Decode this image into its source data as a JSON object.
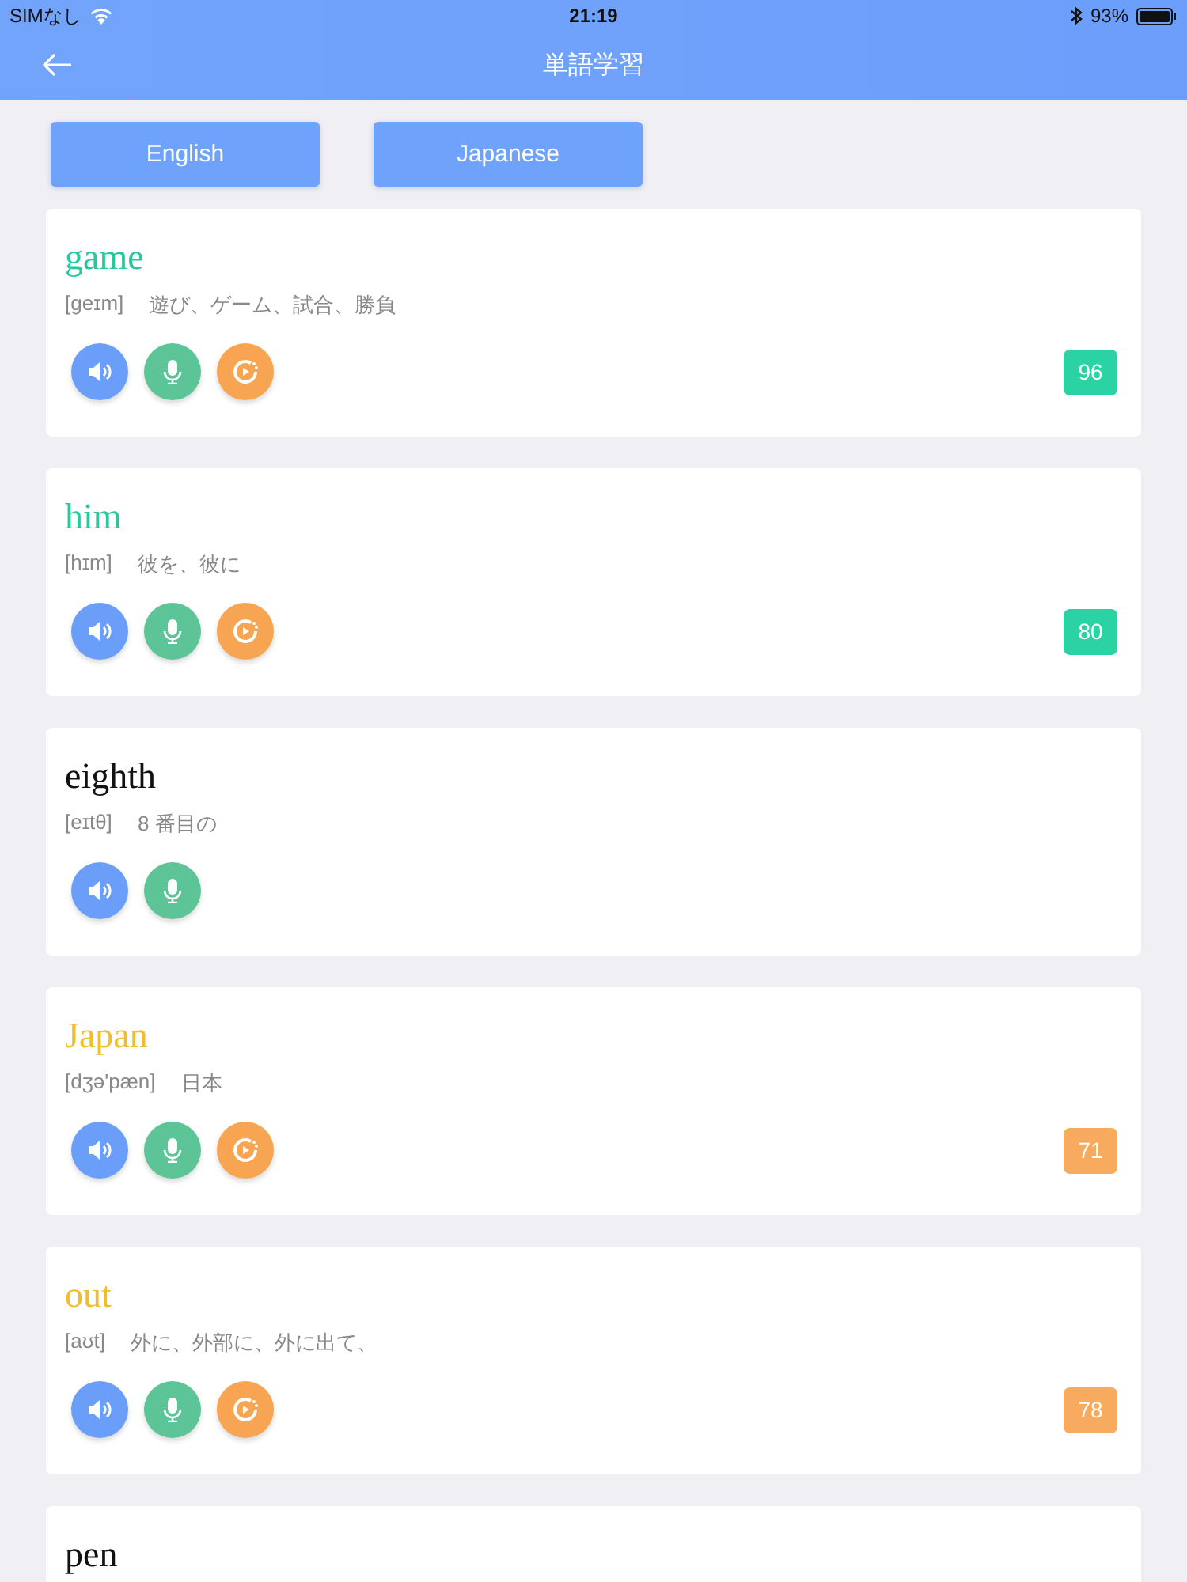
{
  "status_bar": {
    "carrier": "SIMなし",
    "time": "21:19",
    "battery": "93%"
  },
  "nav": {
    "title": "単語学習"
  },
  "tabs": [
    {
      "label": "English"
    },
    {
      "label": "Japanese"
    }
  ],
  "words": [
    {
      "word": "game",
      "color": "#26c99c",
      "phonetic": "[geɪm]",
      "meaning": "遊び、ゲーム、試合、勝負",
      "playback": true,
      "score": {
        "value": "96",
        "color": "#2bd3a4"
      }
    },
    {
      "word": "him",
      "color": "#26c99c",
      "phonetic": "[hɪm]",
      "meaning": "彼を、彼に",
      "playback": true,
      "score": {
        "value": "80",
        "color": "#2bd3a4"
      }
    },
    {
      "word": "eighth",
      "color": "#111111",
      "phonetic": "[eɪtθ]",
      "meaning": "8 番目の",
      "playback": false
    },
    {
      "word": "Japan",
      "color": "#f0bd2c",
      "phonetic": "[dʒə'pæn]",
      "meaning": "日本",
      "playback": true,
      "score": {
        "value": "71",
        "color": "#f8ab5e"
      }
    },
    {
      "word": "out",
      "color": "#f0bd2c",
      "phonetic": "[aʊt]",
      "meaning": "外に、外部に、外に出て、",
      "playback": true,
      "score": {
        "value": "78",
        "color": "#f8ab5e"
      }
    },
    {
      "word": "pen",
      "color": "#111111"
    }
  ]
}
